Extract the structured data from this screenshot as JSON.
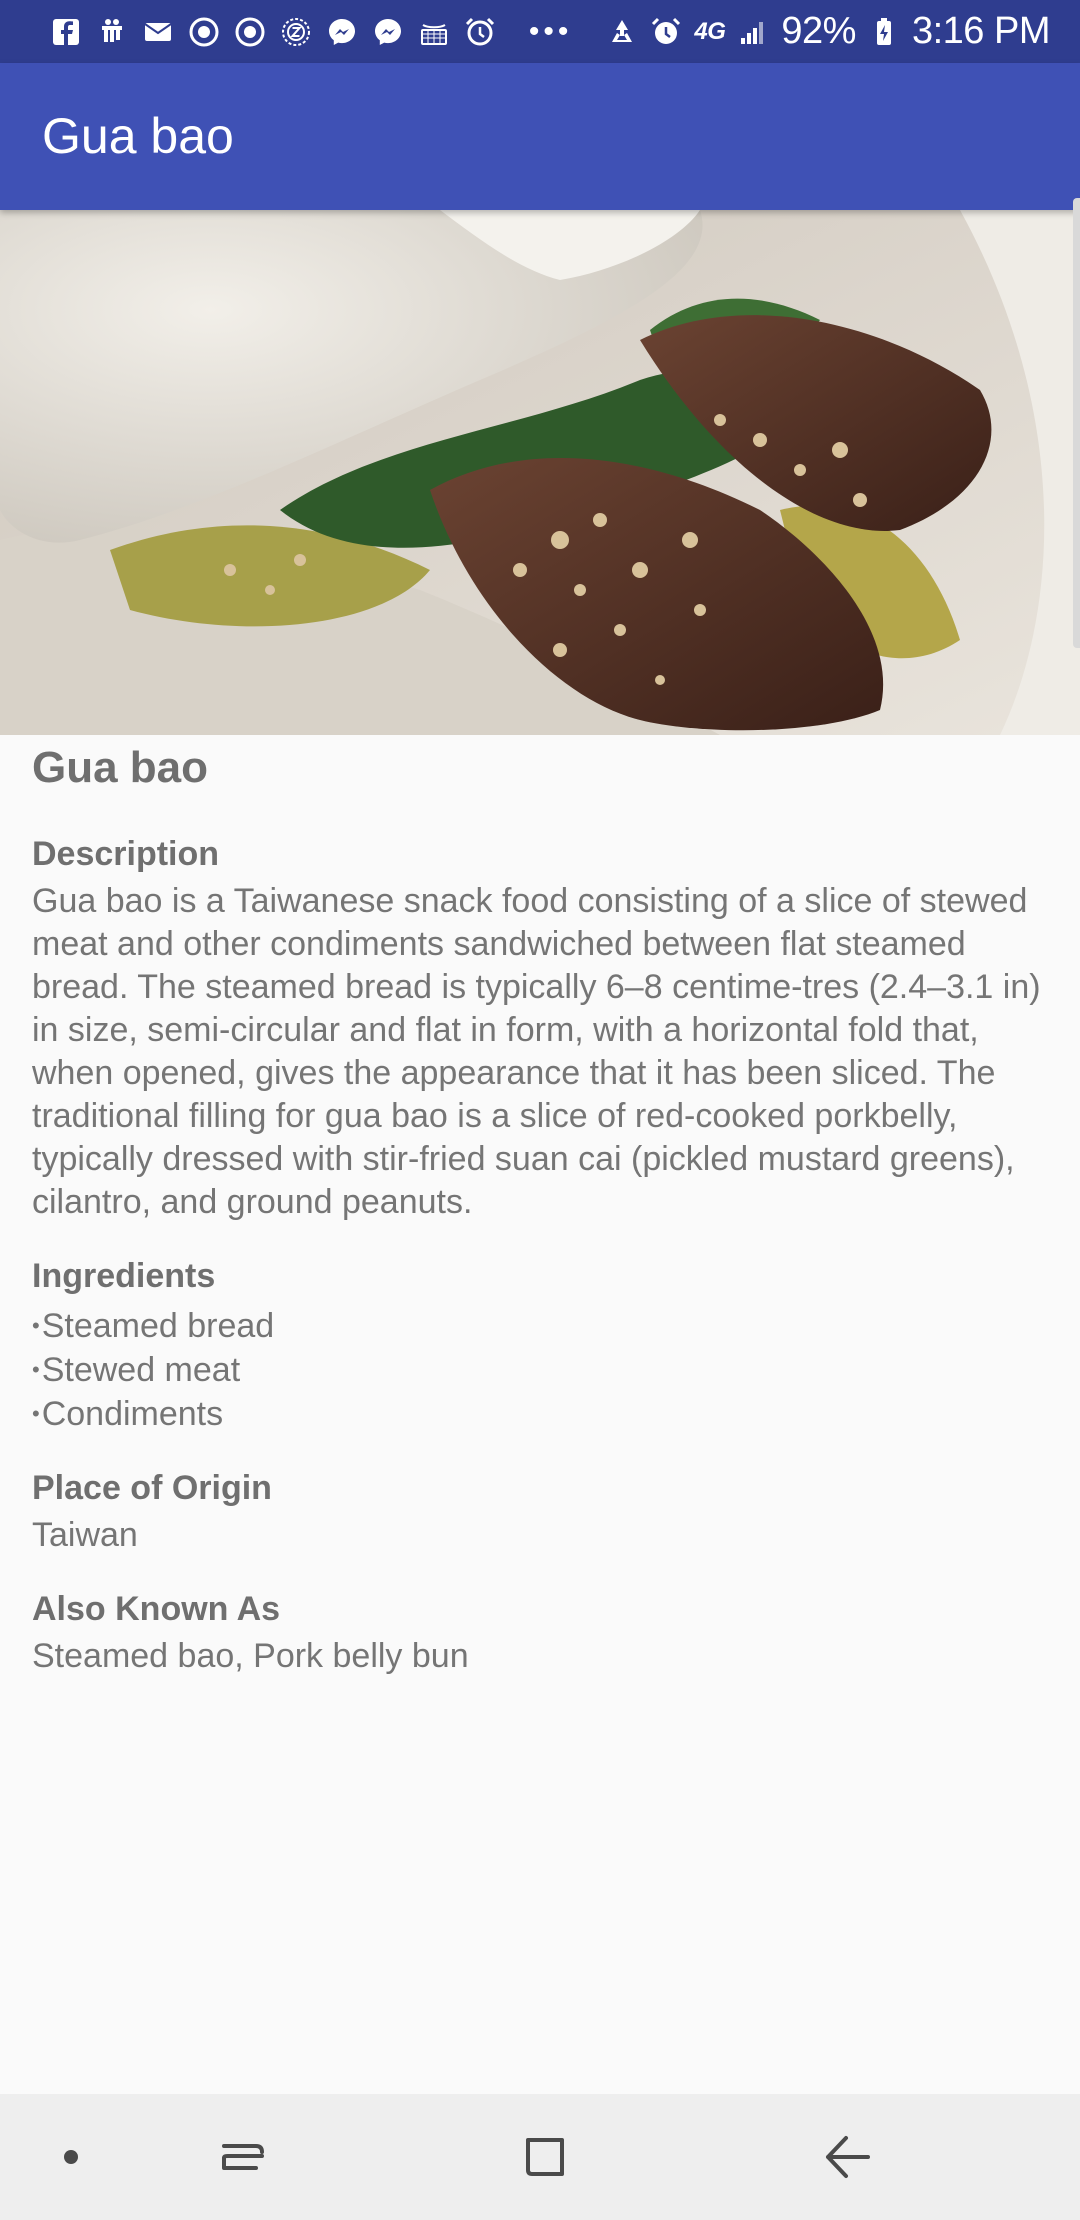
{
  "status_bar": {
    "battery": "92%",
    "time": "3:16 PM",
    "network": "4G",
    "notification_icons": [
      "facebook-icon",
      "hand-icon",
      "mail-icon",
      "target-icon",
      "target-icon",
      "z-badge-icon",
      "messenger-icon",
      "messenger-icon",
      "amazon-icon",
      "alarm-icon"
    ],
    "more_indicator": "•••"
  },
  "app_bar": {
    "title": "Gua bao"
  },
  "detail": {
    "name": "Gua bao",
    "description_label": "Description",
    "description": "Gua bao is a Taiwanese snack food consisting of a slice of stewed meat and other condiments sandwiched between flat steamed bread. The steamed bread is typically 6–8 centime-tres (2.4–3.1 in) in size, semi-circular and flat in form, with a horizontal fold that, when opened, gives the appearance that it has been sliced. The traditional filling for gua bao is a slice of red-cooked porkbelly, typically dressed with stir-fried suan cai (pickled mustard greens), cilantro, and ground peanuts.",
    "ingredients_label": "Ingredients",
    "ingredients": [
      "Steamed bread",
      "Stewed meat",
      "Condiments"
    ],
    "origin_label": "Place of Origin",
    "origin": "Taiwan",
    "aka_label": "Also Known As",
    "aka": "Steamed bao, Pork belly bun"
  },
  "colors": {
    "status_bar": "#2f3d8f",
    "app_bar": "#3f51b5",
    "background": "#fafafa",
    "text": "#757575"
  },
  "nav_bar": {
    "buttons": [
      "dot-icon",
      "recent-apps-icon",
      "home-icon",
      "back-icon"
    ]
  }
}
